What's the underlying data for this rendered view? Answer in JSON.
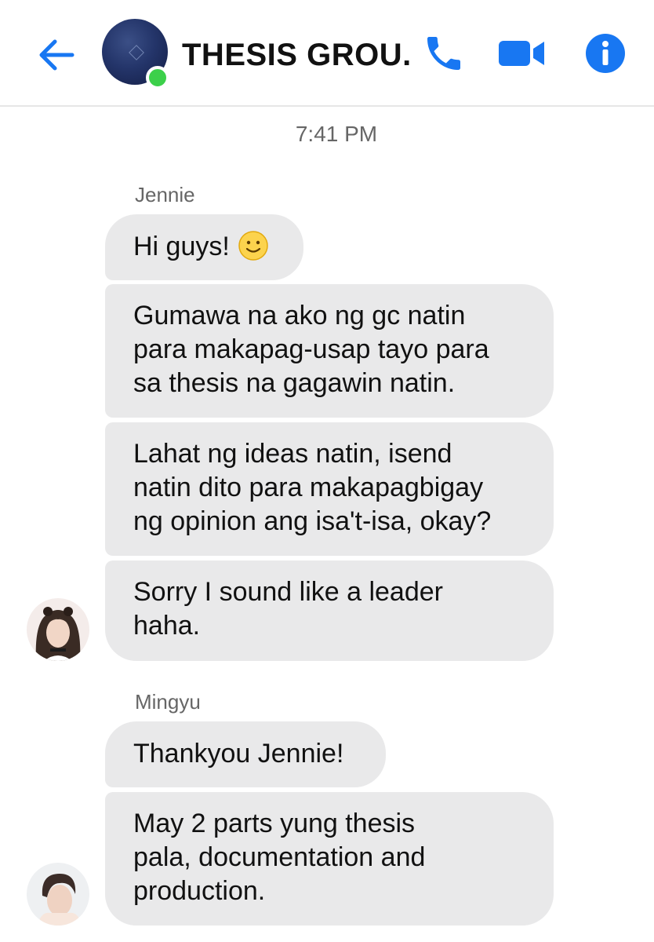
{
  "header": {
    "title": "THESIS GROU...",
    "back_icon": "arrow-left-icon",
    "call_icon": "phone-icon",
    "video_icon": "video-camera-icon",
    "info_icon": "info-icon",
    "accent_color": "#1877f2",
    "online_color": "#3cd04a"
  },
  "conversation": {
    "timestamp": "7:41 PM",
    "groups": [
      {
        "sender": "Jennie",
        "messages": [
          "Hi guys!",
          "Gumawa na ako ng gc natin\npara makapag-usap tayo para\nsa thesis na gagawin natin.",
          "Lahat ng ideas natin, isend\nnatin dito para makapagbigay\nng opinion ang isa't-isa, okay?",
          "Sorry I sound like a leader\nhaha."
        ],
        "emoji": "smiling-face-icon"
      },
      {
        "sender": "Mingyu",
        "messages": [
          "Thankyou Jennie!",
          "May 2 parts yung thesis\npala, documentation and\nproduction."
        ]
      }
    ]
  },
  "colors": {
    "bubble_bg": "#e9e9ea",
    "meta_text": "#666666"
  }
}
